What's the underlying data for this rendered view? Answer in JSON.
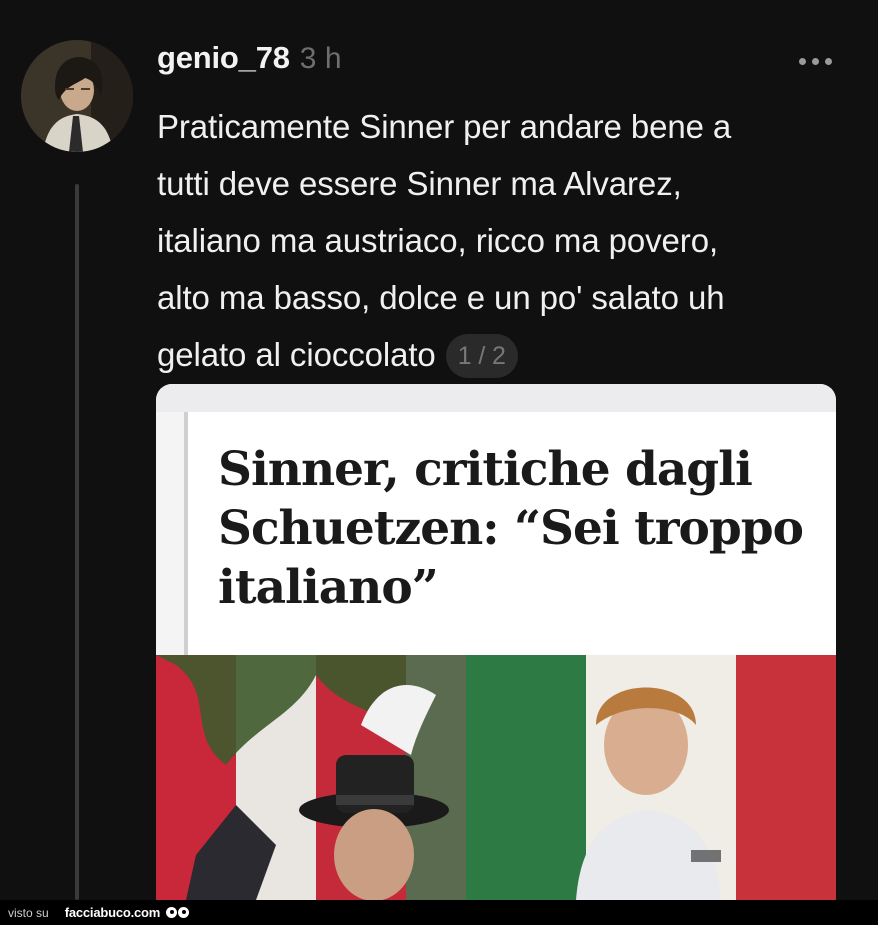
{
  "comment": {
    "username": "genio_78",
    "time": "3 h",
    "text_lines": [
      "Praticamente Sinner per andare bene a",
      "tutti deve essere Sinner ma Alvarez,",
      "italiano ma austriaco, ricco ma povero,",
      "alto ma basso, dolce e un po' salato uh",
      "gelato al cioccolato"
    ],
    "image_counter": "1 / 2"
  },
  "article_card": {
    "headline_lines": [
      "Sinner, critiche dagli",
      "Schuetzen: “Sei troppo",
      "italiano”"
    ]
  },
  "icons": {
    "more": "more-horizontal-icon",
    "avatar": "user-avatar"
  },
  "footer": {
    "visto_su": "visto su",
    "brand": "facciabuco.com"
  },
  "colors": {
    "background": "#101010",
    "text": "#f0f0f0",
    "muted": "#6e6e6e",
    "thread_line": "#3a3a3a"
  }
}
